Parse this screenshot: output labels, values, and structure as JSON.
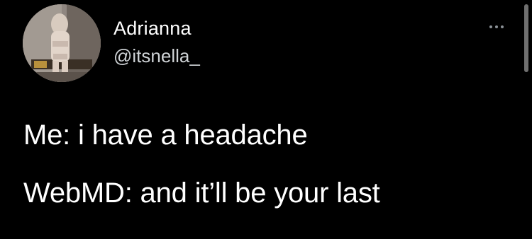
{
  "tweet": {
    "author": {
      "display_name": "Adrianna",
      "handle": "@itsnella_"
    },
    "more_icon": "ellipsis-icon",
    "lines": [
      "Me: i have a headache",
      "WebMD: and it’ll be your last"
    ]
  },
  "colors": {
    "background": "#000000",
    "text": "#ffffff",
    "handle": "#cfd3d6",
    "icon": "#8b9196"
  }
}
